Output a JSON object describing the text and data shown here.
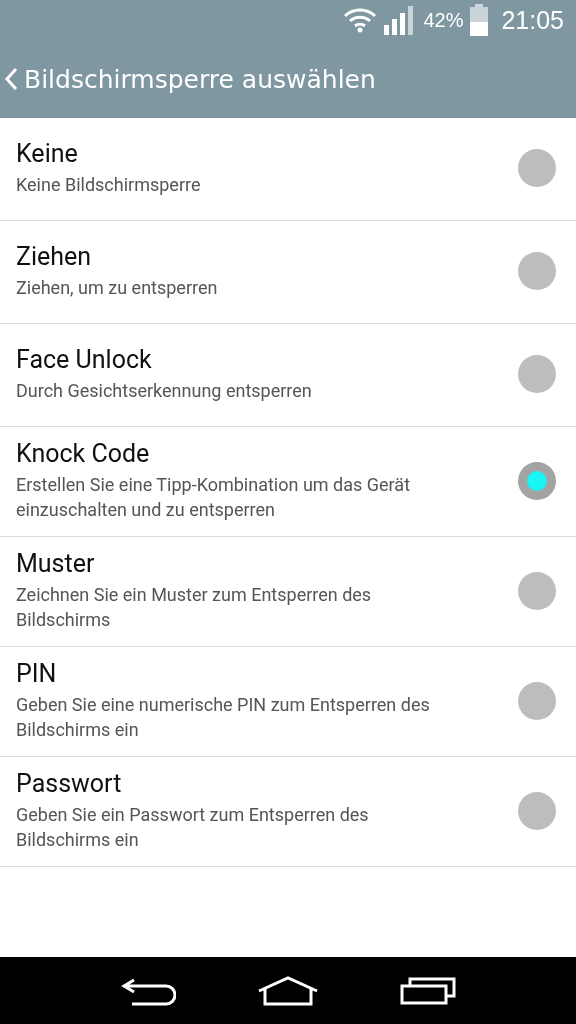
{
  "status_bar": {
    "battery_percent": "42%",
    "time": "21:05"
  },
  "header": {
    "title": "Bildschirmsperre auswählen"
  },
  "options": [
    {
      "title": "Keine",
      "subtitle": "Keine Bildschirmsperre",
      "selected": false
    },
    {
      "title": "Ziehen",
      "subtitle": "Ziehen, um zu entsperren",
      "selected": false
    },
    {
      "title": "Face Unlock",
      "subtitle": "Durch Gesichtserkennung entsperren",
      "selected": false
    },
    {
      "title": "Knock Code",
      "subtitle": "Erstellen Sie eine Tipp-Kombination um das Gerät einzuschalten und zu entsperren",
      "selected": true
    },
    {
      "title": "Muster",
      "subtitle": "Zeichnen Sie ein Muster zum Entsperren des Bildschirms",
      "selected": false
    },
    {
      "title": "PIN",
      "subtitle": "Geben Sie eine numerische PIN zum Entsperren des Bildschirms ein",
      "selected": false
    },
    {
      "title": "Passwort",
      "subtitle": "Geben Sie ein Passwort zum Entsperren des Bildschirms ein",
      "selected": false
    }
  ]
}
